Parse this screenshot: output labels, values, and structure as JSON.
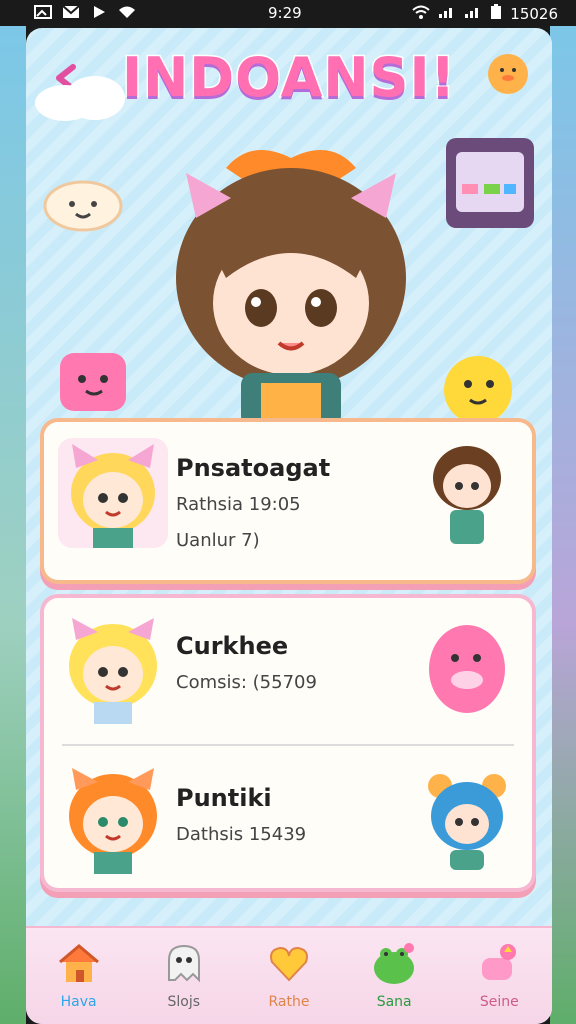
{
  "status_bar": {
    "time": "9:29",
    "battery": "15026"
  },
  "header": {
    "title": "INDOANSI!"
  },
  "cards": [
    {
      "name": "Pnsatoagat",
      "line1": "Rathsia 19:05",
      "line2": "Uanlur 7)"
    },
    {
      "name": "Curkhee",
      "line1": "Comsis: (55709"
    },
    {
      "name": "Puntiki",
      "line1": "Dathsis 15439"
    }
  ],
  "bottom_nav": [
    {
      "label": "Hava",
      "color": "#2ea6e8"
    },
    {
      "label": "Slojs",
      "color": "#666666"
    },
    {
      "label": "Rathe",
      "color": "#e0844a"
    },
    {
      "label": "Sana",
      "color": "#2c9a3e"
    },
    {
      "label": "Seine",
      "color": "#d05a8a"
    }
  ],
  "colors": {
    "accent": "#f3a0b7",
    "card_border": "#f7b98c",
    "title_shadow": "#b46cd8"
  }
}
